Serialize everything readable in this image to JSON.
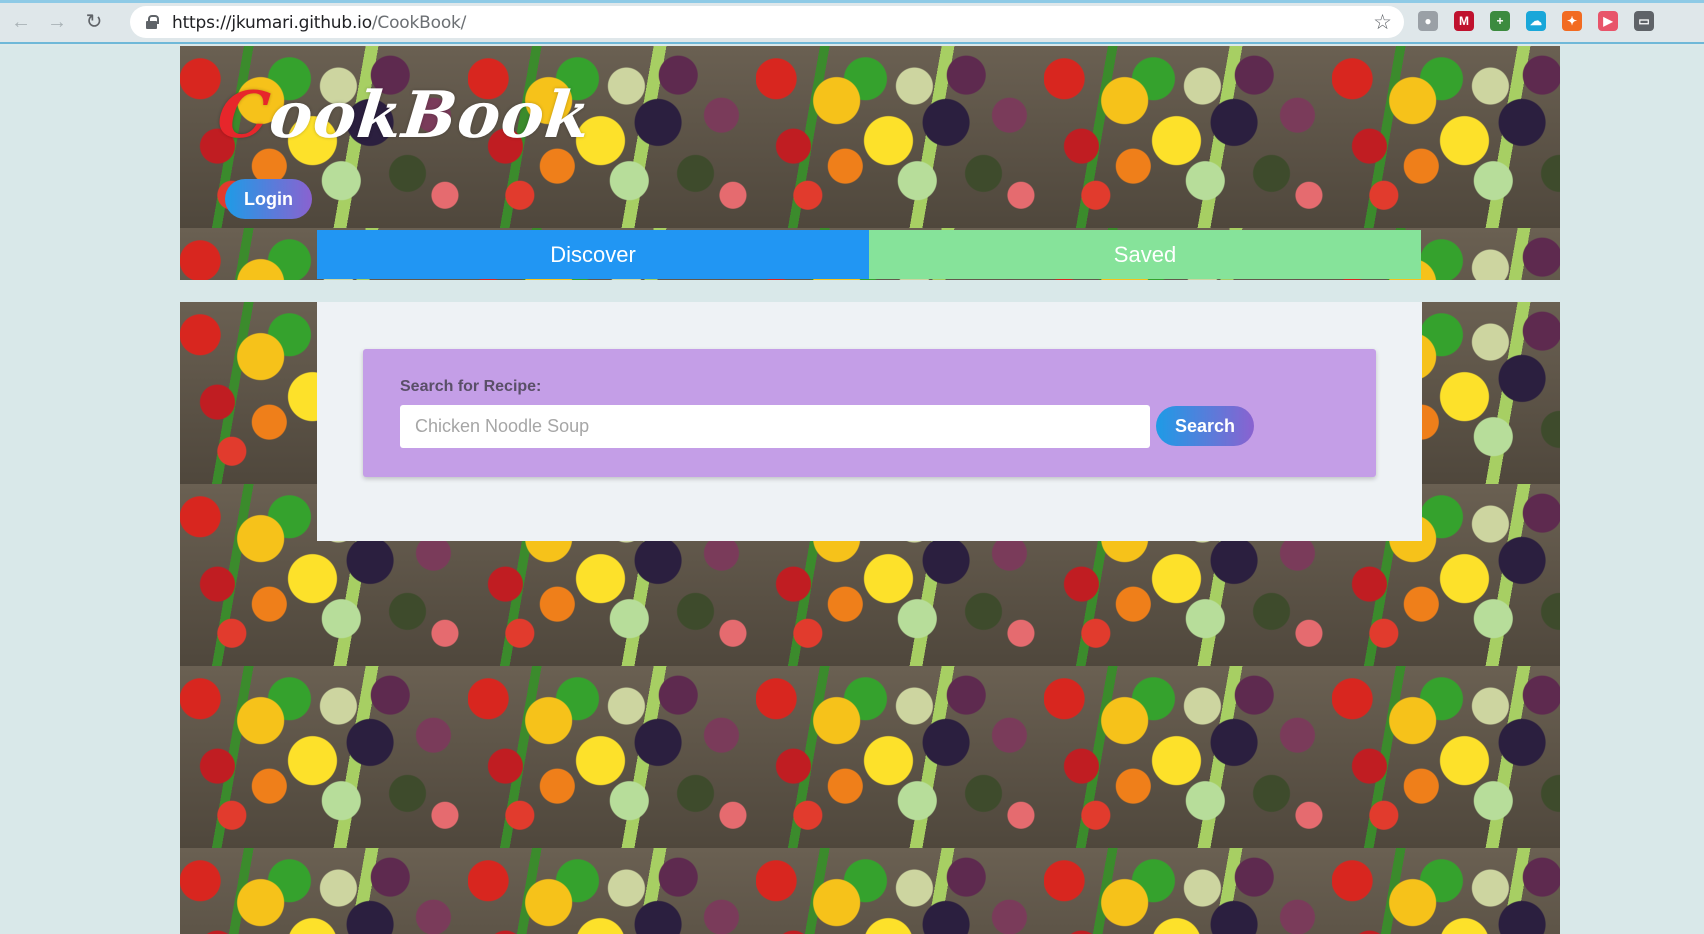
{
  "browser": {
    "url_host": "https://jkumari.github.io",
    "url_path": "/CookBook/",
    "back_icon": "arrow-left-icon",
    "forward_icon": "arrow-right-icon",
    "reload_icon": "reload-icon",
    "bookmark_icon": "star-icon",
    "extensions": [
      {
        "name": "record-icon",
        "glyph": "●",
        "color": "#9aa0a6"
      },
      {
        "name": "shield-icon",
        "glyph": "M",
        "color": "#c0122e"
      },
      {
        "name": "download-extension-icon",
        "glyph": "+",
        "color": "#3c8b3f"
      },
      {
        "name": "cloud-icon",
        "glyph": "☁",
        "color": "#19a7d9"
      },
      {
        "name": "pinwheel-icon",
        "glyph": "✦",
        "color": "#f26b21"
      },
      {
        "name": "video-icon",
        "glyph": "▶",
        "color": "#e8546a"
      },
      {
        "name": "window-icon",
        "glyph": "▭",
        "color": "#5f6368"
      }
    ]
  },
  "header": {
    "logo_first": "C",
    "logo_rest": "ookBook",
    "login_label": "Login"
  },
  "tabs": [
    {
      "label": "Discover",
      "color": "#2196f3"
    },
    {
      "label": "Saved",
      "color": "#86e39a"
    }
  ],
  "search": {
    "label": "Search for Recipe:",
    "placeholder": "Chicken Noodle Soup",
    "button_label": "Search"
  },
  "colors": {
    "card": "#c49ee7",
    "panel": "#eef2f5",
    "button_gradient_start": "#1e9be6",
    "button_gradient_end": "#8a62d0"
  }
}
